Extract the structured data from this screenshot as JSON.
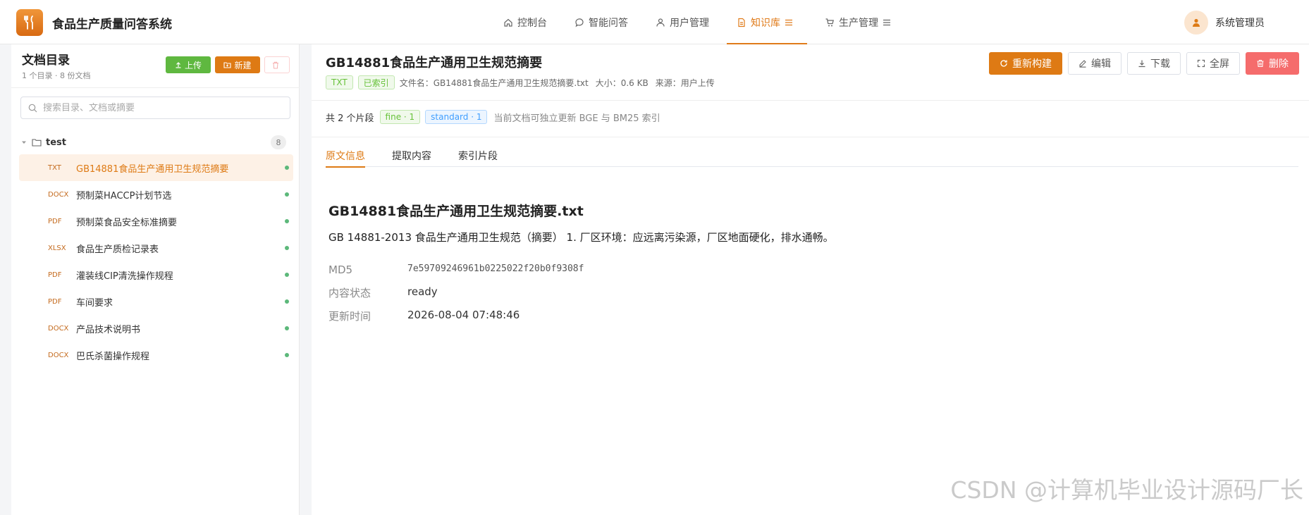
{
  "header": {
    "app_title": "食品生产质量问答系统",
    "nav": [
      {
        "label": "控制台",
        "icon": "home-icon"
      },
      {
        "label": "智能问答",
        "icon": "chat-icon"
      },
      {
        "label": "用户管理",
        "icon": "user-icon"
      },
      {
        "label": "知识库",
        "icon": "document-icon",
        "active": true
      },
      {
        "label": "生产管理",
        "icon": "cart-icon"
      }
    ],
    "user_name": "系统管理员"
  },
  "sidebar": {
    "title": "文档目录",
    "subtitle": "1 个目录 · 8 份文档",
    "upload_label": "上传",
    "new_label": "新建",
    "search_placeholder": "搜索目录、文档或摘要",
    "folder": {
      "name": "test",
      "count": "8"
    },
    "files": [
      {
        "type": "TXT",
        "name": "GB14881食品生产通用卫生规范摘要",
        "active": true
      },
      {
        "type": "DOCX",
        "name": "预制菜HACCP计划节选"
      },
      {
        "type": "PDF",
        "name": "预制菜食品安全标准摘要"
      },
      {
        "type": "XLSX",
        "name": "食品生产质检记录表"
      },
      {
        "type": "PDF",
        "name": "灌装线CIP清洗操作规程"
      },
      {
        "type": "PDF",
        "name": "车间要求"
      },
      {
        "type": "DOCX",
        "name": "产品技术说明书"
      },
      {
        "type": "DOCX",
        "name": "巴氏杀菌操作规程"
      }
    ]
  },
  "main": {
    "title": "GB14881食品生产通用卫生规范摘要",
    "tag_type": "TXT",
    "tag_indexed": "已索引",
    "file_name": "文件名：GB14881食品生产通用卫生规范摘要.txt",
    "size": "大小：0.6 KB",
    "source": "来源：用户上传",
    "actions": {
      "rebuild": "重新构建",
      "edit": "编辑",
      "download": "下载",
      "fullscreen": "全屏",
      "delete": "删除"
    },
    "segments": {
      "count_text": "共 2 个片段",
      "fine": "fine · 1",
      "standard": "standard · 1",
      "note": "当前文档可独立更新 BGE 与 BM25 索引"
    },
    "tabs": [
      "原文信息",
      "提取内容",
      "索引片段"
    ],
    "content": {
      "title": "GB14881食品生产通用卫生规范摘要.txt",
      "text": "GB 14881-2013 食品生产通用卫生规范（摘要） 1. 厂区环境：应远离污染源，厂区地面硬化，排水通畅。",
      "md5_label": "MD5",
      "md5": "7e59709246961b0225022f20b0f9308f",
      "status_label": "内容状态",
      "status": "ready",
      "updated_label": "更新时间",
      "updated": "2026-08-04 07:48:46"
    }
  },
  "watermark": "CSDN @计算机毕业设计源码厂长",
  "colors": {
    "accent": "#de7a14",
    "success": "#5fb840",
    "danger": "#f56c6c"
  }
}
